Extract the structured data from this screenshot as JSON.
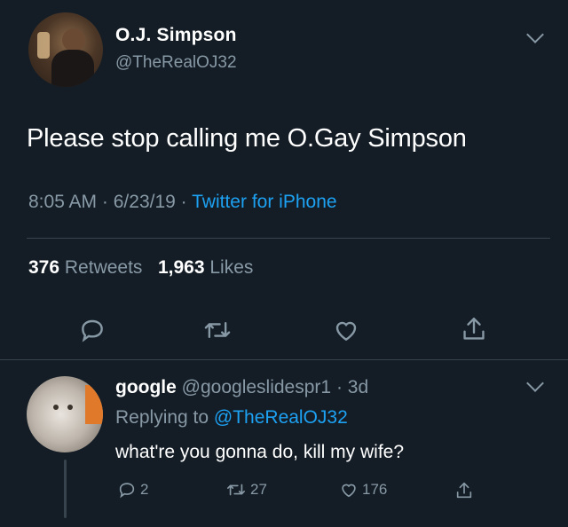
{
  "tweet": {
    "author_name": "O.J. Simpson",
    "author_handle": "@TheRealOJ32",
    "text": "Please stop calling me O.Gay Simpson",
    "time": "8:05 AM",
    "date": "6/23/19",
    "separator": "·",
    "client": "Twitter for iPhone",
    "retweets_count": "376",
    "retweets_label": "Retweets",
    "likes_count": "1,963",
    "likes_label": "Likes"
  },
  "reply": {
    "author_name": "google",
    "author_handle": "@googleslidespr1",
    "separator": "·",
    "age": "3d",
    "replying_prefix": "Replying to",
    "replying_to": "@TheRealOJ32",
    "text": "what're you gonna do, kill my wife?",
    "reply_count": "2",
    "retweet_count": "27",
    "like_count": "176"
  },
  "icons": {
    "reply": "reply-bubble-icon",
    "retweet": "retweet-icon",
    "like": "heart-icon",
    "share": "share-icon",
    "menu": "chevron-down-icon"
  },
  "colors": {
    "background": "#141d26",
    "muted": "#8899a6",
    "link": "#1da1f2",
    "divider": "#38444d"
  }
}
